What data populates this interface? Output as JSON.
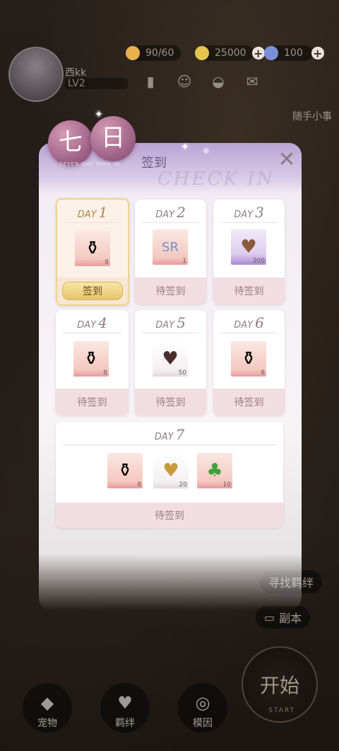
{
  "player": {
    "name": "西kk",
    "level": "LV2"
  },
  "resources": {
    "stamina": "90/60",
    "coins": "25000",
    "gems": "100"
  },
  "side": {
    "top_right_label": "随手小事",
    "bond_label": "寻找羁绊",
    "dungeon_label": "副本"
  },
  "bottom_nav": {
    "pet": "宠物",
    "bond": "羁绊",
    "gene": "模因"
  },
  "start": {
    "label": "开始",
    "sub": "START"
  },
  "dialog": {
    "title_chars": [
      "七",
      "日"
    ],
    "title_sub": "签到",
    "title_en": "SEVEN-DAY SIGN-IN",
    "watermark": "CHECK IN",
    "day_prefix": "DAY",
    "days": [
      {
        "num": "1",
        "items": [
          {
            "icon": "perfume-bottle-icon",
            "count": "8"
          }
        ],
        "status": "签到",
        "claimable": true
      },
      {
        "num": "2",
        "items": [
          {
            "icon": "sr-card-icon",
            "count": "1"
          }
        ],
        "status": "待签到"
      },
      {
        "num": "3",
        "items": [
          {
            "icon": "chocolate-box-icon",
            "count": "200"
          }
        ],
        "status": "待签到"
      },
      {
        "num": "4",
        "items": [
          {
            "icon": "perfume-bottle-icon",
            "count": "8"
          }
        ],
        "status": "待签到"
      },
      {
        "num": "5",
        "items": [
          {
            "icon": "heart-chocolate-box-icon",
            "count": "50"
          }
        ],
        "status": "待签到"
      },
      {
        "num": "6",
        "items": [
          {
            "icon": "perfume-bottle-icon",
            "count": "8"
          }
        ],
        "status": "待签到"
      },
      {
        "num": "7",
        "items": [
          {
            "icon": "perfume-bottle-icon",
            "count": "8"
          },
          {
            "icon": "gold-heart-box-icon",
            "count": "20"
          },
          {
            "icon": "four-leaf-clover-icon",
            "count": "10"
          }
        ],
        "status": "待签到"
      }
    ]
  }
}
